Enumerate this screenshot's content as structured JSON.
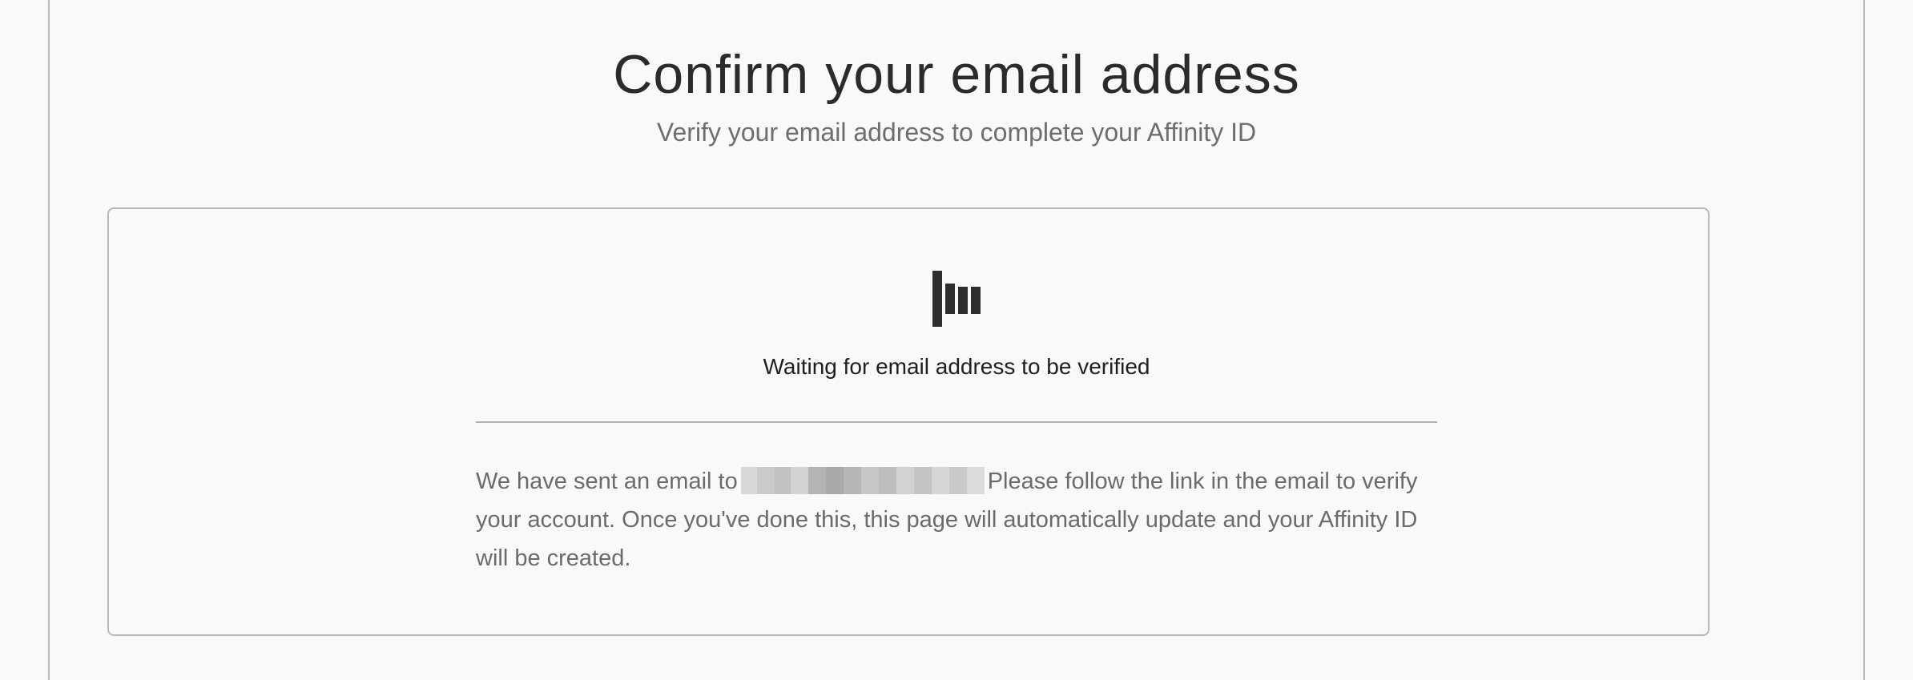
{
  "header": {
    "title": "Confirm your email address",
    "subtitle": "Verify your email address to complete your Affinity ID"
  },
  "card": {
    "loader_icon": "loading-bars-icon",
    "status_text": "Waiting for email address to be verified",
    "message_before_email": "We have sent an email to",
    "message_after_email": "Please follow the link in the email to verify your account. Once you've done this, this page will automatically update and your Affinity ID will be created."
  },
  "colors": {
    "background": "#f9f9f9",
    "text_primary": "#2b2b2b",
    "text_secondary": "#6b6b6b",
    "border": "#b9b9b9",
    "loader": "#2d2d2d"
  }
}
